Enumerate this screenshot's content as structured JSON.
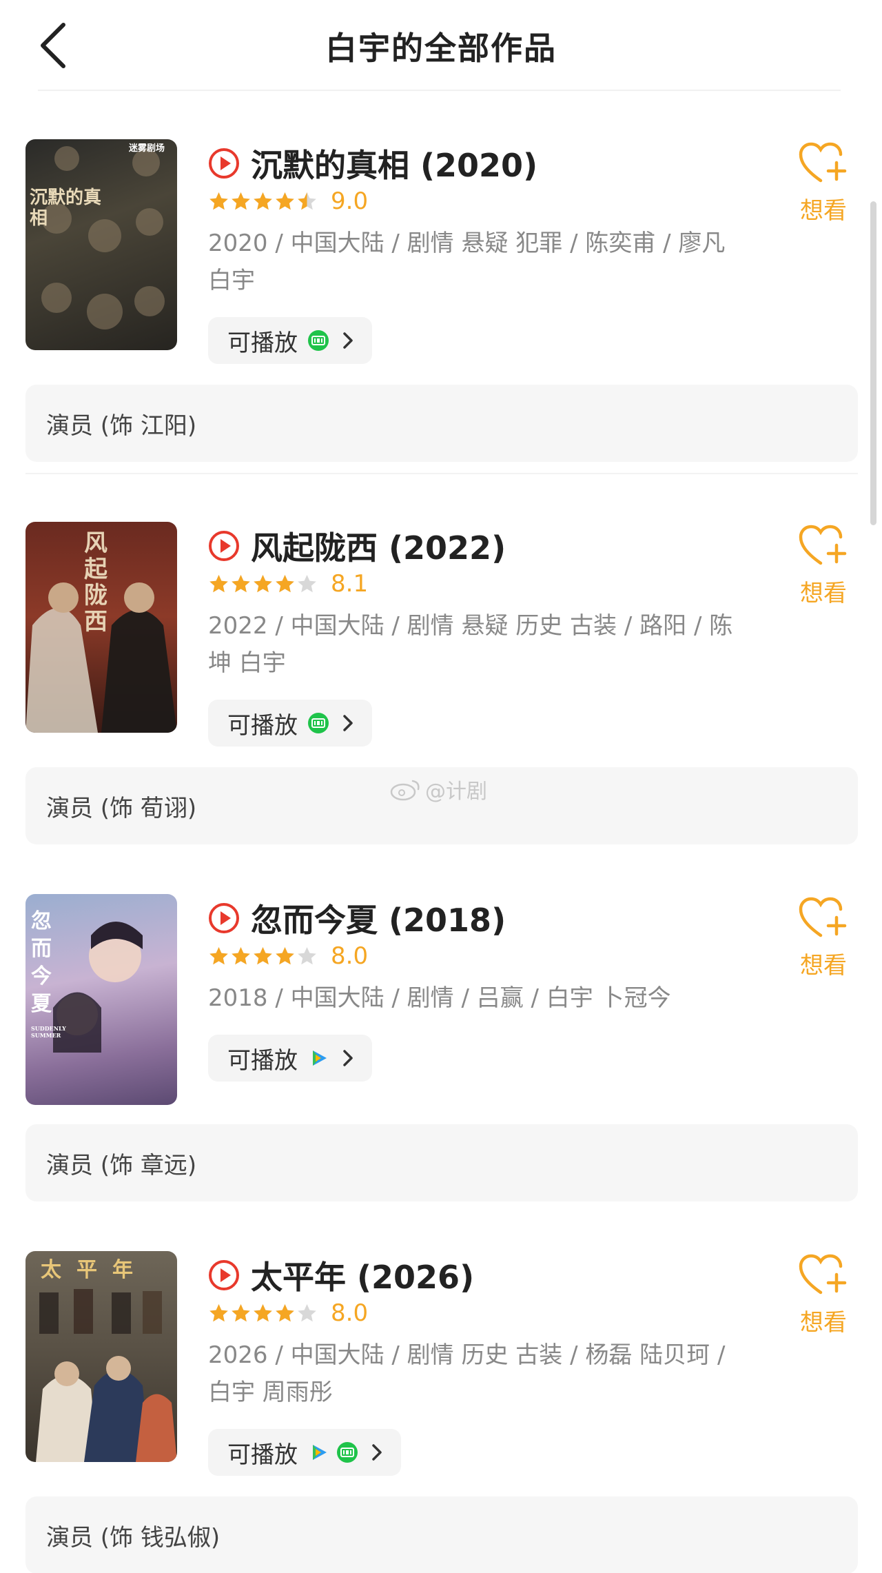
{
  "header": {
    "title": "白宇的全部作品"
  },
  "works": [
    {
      "title": "沉默的真相 (2020)",
      "stars_out_of_5": 4.5,
      "score": "9.0",
      "meta": "2020 / 中国大陆 / 剧情 悬疑 犯罪 / 陈奕甫 / 廖凡 白宇",
      "playable_label": "可播放",
      "platforms": [
        "iqiyi-icon"
      ],
      "want_label": "想看",
      "role": "演员 (饰 江阳)",
      "poster_text": "沉默的真相",
      "poster_logo": "迷雾剧场"
    },
    {
      "title": "风起陇西 (2022)",
      "stars_out_of_5": 4,
      "score": "8.1",
      "meta": "2022 / 中国大陆 / 剧情 悬疑 历史 古装 / 路阳 / 陈坤 白宇",
      "playable_label": "可播放",
      "platforms": [
        "iqiyi-icon"
      ],
      "want_label": "想看",
      "role": "演员 (饰 荀诩)",
      "poster_text": "风起陇西"
    },
    {
      "title": "忽而今夏 (2018)",
      "stars_out_of_5": 4,
      "score": "8.0",
      "meta": "2018 / 中国大陆 / 剧情 / 吕赢 / 白宇 卜冠今",
      "playable_label": "可播放",
      "platforms": [
        "tencent-video-icon"
      ],
      "want_label": "想看",
      "role": "演员 (饰 章远)",
      "poster_text": "忽而今夏",
      "poster_subtitle": "SUDDENLY SUMMER"
    },
    {
      "title": "太平年 (2026)",
      "stars_out_of_5": 4,
      "score": "8.0",
      "meta": "2026 / 中国大陆 / 剧情 历史 古装 / 杨磊 陆贝珂 / 白宇 周雨彤",
      "playable_label": "可播放",
      "platforms": [
        "tencent-video-icon",
        "iqiyi-icon"
      ],
      "want_label": "想看",
      "role": "演员 (饰 钱弘俶)",
      "poster_text": "太平年"
    }
  ],
  "watermark": "@计剧",
  "colors": {
    "accent": "#f5a623",
    "play_red": "#e8392c",
    "iqiyi_green": "#1fc34a",
    "star_empty": "#d8d8d8",
    "meta_gray": "#888888",
    "role_bg": "#f6f6f6"
  }
}
